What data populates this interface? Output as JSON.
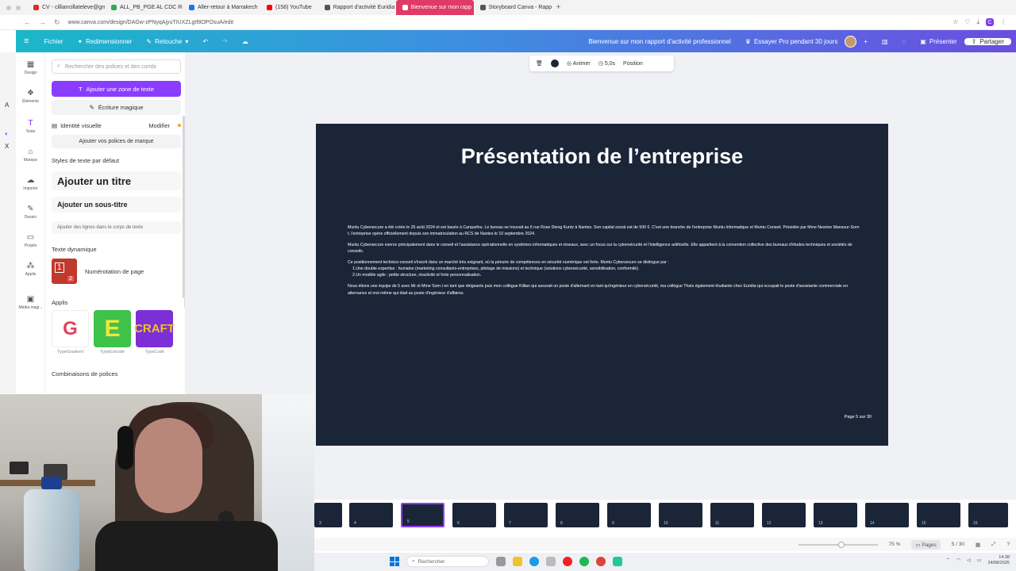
{
  "browser": {
    "tabs": [
      {
        "label": "CV - cilliancillateleve@gm",
        "color": "#d93025",
        "active": false
      },
      {
        "label": "ALL_PB_PGE AL CDC Re",
        "color": "#34a853",
        "active": false
      },
      {
        "label": "Aller-retour à Marrakech",
        "color": "#1a73e8",
        "active": false
      },
      {
        "label": "(158) YouTube",
        "color": "#ff0000",
        "active": false
      },
      {
        "label": "Rapport d'activité Euridia",
        "color": "#555555",
        "active": false
      },
      {
        "label": "Bienvenue sur mon rapp",
        "color": "#ffffff",
        "active": true
      },
      {
        "label": "Storyboard Canva - Rapp",
        "color": "#555555",
        "active": false
      }
    ],
    "url": "www.canva.com/design/DAGw-zPNyqAjyuTIUXZLgtf8OPOsuA/edit"
  },
  "topbar": {
    "file": "Fichier",
    "resize": "Redimensionner",
    "retouch": "Retouche",
    "doc_title": "Bienvenue sur mon rapport d'activité professionnel",
    "try_pro": "Essayer Pro pendant 30 jours",
    "present": "Présenter",
    "share": "Partager"
  },
  "rail": {
    "items": [
      {
        "label": "Design",
        "icon": "layout-icon"
      },
      {
        "label": "Éléments",
        "icon": "shapes-icon"
      },
      {
        "label": "Texte",
        "icon": "text-icon"
      },
      {
        "label": "Marque",
        "icon": "brand-icon"
      },
      {
        "label": "Importer",
        "icon": "upload-icon"
      },
      {
        "label": "Dessin",
        "icon": "draw-icon"
      },
      {
        "label": "Projets",
        "icon": "folder-icon"
      },
      {
        "label": "Applis",
        "icon": "apps-icon"
      },
      {
        "label": "Média magi...",
        "icon": "magic-media-icon"
      }
    ]
  },
  "panel": {
    "search_placeholder": "Rechercher des polices et des combi",
    "add_text": "Ajouter une zone de texte",
    "magic_write": "Écriture magique",
    "brand_identity": "Identité visuelle",
    "modify": "Modifier",
    "add_brand_fonts": "Ajouter vos polices de marque",
    "default_styles": "Styles de texte par défaut",
    "add_title": "Ajouter un titre",
    "add_subtitle": "Ajouter un sous-titre",
    "add_body": "Ajouter des lignes dans le corps de texte",
    "dynamic_text": "Texte dynamique",
    "page_numbering": "Numérotation de page",
    "apps_heading": "Applis",
    "apps": [
      {
        "name": "TypeGradient",
        "glyph": "G"
      },
      {
        "name": "TypeExtrude",
        "glyph": "E"
      },
      {
        "name": "TypeCraft",
        "glyph": "CRAFT"
      }
    ],
    "font_combos": "Combinaisons de polices"
  },
  "context_toolbar": {
    "animate": "Animer",
    "duration": "5,0s",
    "position": "Position"
  },
  "slide": {
    "title": "Présentation de l’entreprise",
    "paragraphs": [
      "Muntu Cybersecure a été créée le 26 août 2024 et est basée à Carquefou. Le bureau se trouvait au 6 rue Rose Dieng Kuntz à Nantes. Son capital social est de 500 €. C'est une branche de l'entreprise Muntu Informatique et Muntu Conseil. Présidée par Mme Nesrine Mansour-Sorn t, l'entreprise opère officiellement depuis son immatriculation au RCS de Nantes le 10 septembre 2024.",
      "Muntu Cybersecure exerce principalement dans le conseil et l'assistance opérationnelle en systèmes informatiques et réseaux, avec un focus sur la cybersécurité et l'intelligence artificielle. Elle appartient à la convention collective des bureaux d'études techniques et sociétés de conseils.",
      "Ce positionnement technico-conseil s'inscrit dans un marché très exigeant, où la pénurie de compétences en sécurité numérique est forte. Muntu Cybersecure se distingue par :"
    ],
    "list": [
      "1.Une double expertise : humaine (marketing consultants-entreprises, pilotage de missions) et technique (solutions cybersécurité, sensibilisation, conformité).",
      "2.Un modèle agile : petite structure, réactivité et forte personnalisation."
    ],
    "closing": "Nous étions une équipe de 5 avec Mr et Mme Sorn t en tant que dirigeants puis mon collègue Killian qui assurait un poste d'alternant en tant qu'ingénieur en cybersécurité, ma collègue Thaïs également étudiante chez Euridia qui occupait le poste d'assistante commerciale en alternance et moi même qui était au poste d'ingénieur d'affaires.",
    "footer": "Page 5 sur 30"
  },
  "pages": [
    "3",
    "4",
    "5",
    "6",
    "7",
    "8",
    "9",
    "10",
    "11",
    "12",
    "13",
    "14",
    "15",
    "16"
  ],
  "selected_page": "5",
  "footer": {
    "zoom": "75 %",
    "pages": "Pages",
    "page_count": "5 / 30"
  },
  "taskbar": {
    "search": "Rechercher",
    "time": "14:38",
    "date": "24/08/2025"
  }
}
